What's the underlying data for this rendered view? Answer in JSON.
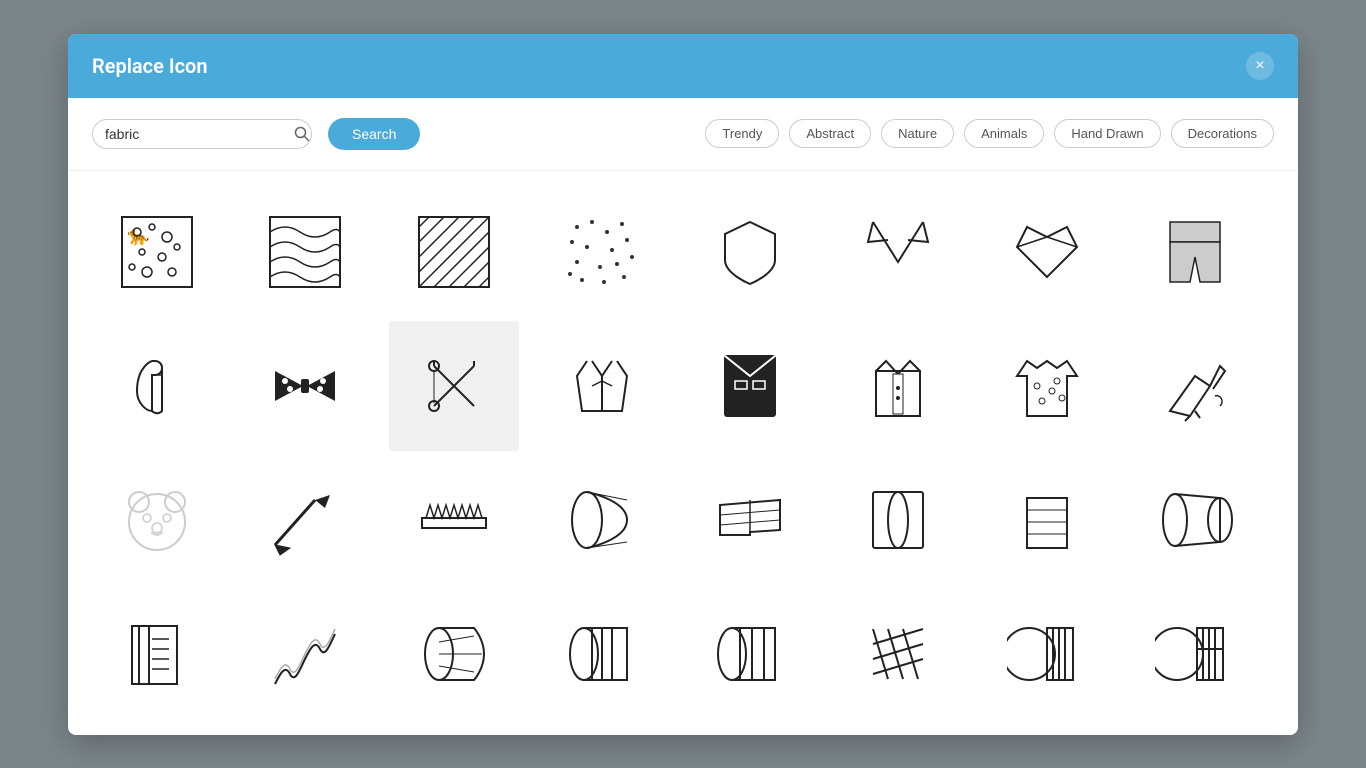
{
  "modal": {
    "title": "Replace Icon",
    "close_label": "×"
  },
  "search": {
    "value": "fabric",
    "placeholder": "fabric",
    "button_label": "Search"
  },
  "filters": [
    {
      "label": "Trendy",
      "id": "trendy"
    },
    {
      "label": "Abstract",
      "id": "abstract"
    },
    {
      "label": "Nature",
      "id": "nature"
    },
    {
      "label": "Animals",
      "id": "animals"
    },
    {
      "label": "Hand Drawn",
      "id": "hand-drawn"
    },
    {
      "label": "Decorations",
      "id": "decorations"
    }
  ],
  "icons": [
    {
      "id": "leopard-pattern",
      "label": "Leopard Pattern"
    },
    {
      "id": "wave-pattern",
      "label": "Wave Pattern"
    },
    {
      "id": "diagonal-lines",
      "label": "Diagonal Lines"
    },
    {
      "id": "dots-pattern",
      "label": "Dots Pattern"
    },
    {
      "id": "shield-fabric",
      "label": "Shield Fabric"
    },
    {
      "id": "collar-v",
      "label": "V Collar"
    },
    {
      "id": "geometric-heart",
      "label": "Geometric Heart"
    },
    {
      "id": "pants",
      "label": "Pants"
    },
    {
      "id": "safety-pin",
      "label": "Safety Pin"
    },
    {
      "id": "bow-tie",
      "label": "Bow Tie"
    },
    {
      "id": "needles-cross",
      "label": "Needles Cross"
    },
    {
      "id": "coat-design",
      "label": "Coat Design"
    },
    {
      "id": "suit-vest",
      "label": "Suit Vest"
    },
    {
      "id": "shirt-collar",
      "label": "Shirt Collar"
    },
    {
      "id": "hawaii-shirt",
      "label": "Hawaii Shirt"
    },
    {
      "id": "sewing-action",
      "label": "Sewing Action"
    },
    {
      "id": "bear-face",
      "label": "Bear Face"
    },
    {
      "id": "fabric-cutter",
      "label": "Fabric Cutter"
    },
    {
      "id": "saw-tool",
      "label": "Saw Tool"
    },
    {
      "id": "fabric-roll",
      "label": "Fabric Roll"
    },
    {
      "id": "folded-fabric",
      "label": "Folded Fabric"
    },
    {
      "id": "roll-fabric2",
      "label": "Roll Fabric 2"
    },
    {
      "id": "fabric-sheet",
      "label": "Fabric Sheet"
    },
    {
      "id": "double-roll",
      "label": "Double Roll"
    },
    {
      "id": "notebook",
      "label": "Notebook"
    },
    {
      "id": "wave-texture",
      "label": "Wave Texture"
    },
    {
      "id": "roll-feather",
      "label": "Roll Feather"
    },
    {
      "id": "striped-roll",
      "label": "Striped Roll"
    },
    {
      "id": "striped-roll2",
      "label": "Striped Roll 2"
    },
    {
      "id": "crosshatch",
      "label": "Crosshatch"
    },
    {
      "id": "pattern-roll",
      "label": "Pattern Roll"
    },
    {
      "id": "pattern-roll2",
      "label": "Pattern Roll 2"
    }
  ]
}
